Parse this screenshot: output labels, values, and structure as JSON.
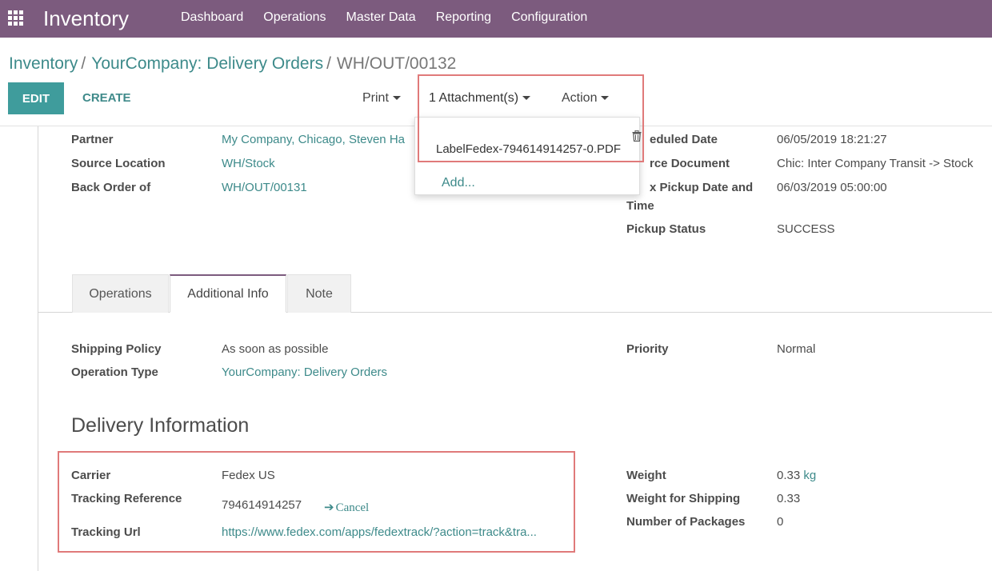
{
  "navbar": {
    "app_title": "Inventory",
    "menu": [
      "Dashboard",
      "Operations",
      "Master Data",
      "Reporting",
      "Configuration"
    ],
    "apps_icon": "grid-icon"
  },
  "breadcrumb": {
    "items": [
      "Inventory",
      "YourCompany: Delivery Orders"
    ],
    "current": "WH/OUT/00132"
  },
  "controls": {
    "edit_label": "EDIT",
    "create_label": "CREATE",
    "print_label": "Print",
    "attachments_label": "1 Attachment(s)",
    "action_label": "Action"
  },
  "attachments_dropdown": {
    "file_name": "LabelFedex-794614914257-0.PDF",
    "add_label": "Add...",
    "delete_icon": "trash-icon"
  },
  "header_fields": {
    "partner_label": "Partner",
    "partner_value": "My Company, Chicago, Steven Ha",
    "source_location_label": "Source Location",
    "source_location_value": "WH/Stock",
    "back_order_label": "Back Order of",
    "back_order_value": "WH/OUT/00131",
    "scheduled_date_label": "eduled Date",
    "scheduled_date_value": "06/05/2019 18:21:27",
    "source_document_label": "rce Document",
    "source_document_value": "Chic: Inter Company Transit -> Stock",
    "pickup_date_label_1": "x Pickup Date and",
    "pickup_date_label_2": "Time",
    "pickup_date_value": "06/03/2019 05:00:00",
    "pickup_status_label": "Pickup Status",
    "pickup_status_value": "SUCCESS"
  },
  "tabs": [
    "Operations",
    "Additional Info",
    "Note"
  ],
  "additional_info": {
    "shipping_policy_label": "Shipping Policy",
    "shipping_policy_value": "As soon as possible",
    "operation_type_label": "Operation Type",
    "operation_type_value": "YourCompany: Delivery Orders",
    "priority_label": "Priority",
    "priority_value": "Normal"
  },
  "delivery_info": {
    "title": "Delivery Information",
    "carrier_label": "Carrier",
    "carrier_value": "Fedex US",
    "tracking_ref_label": "Tracking Reference",
    "tracking_ref_value": "794614914257",
    "cancel_label": "Cancel",
    "tracking_url_label": "Tracking Url",
    "tracking_url_value": "https://www.fedex.com/apps/fedextrack/?action=track&tra...",
    "weight_label": "Weight",
    "weight_value": "0.33",
    "weight_unit": "kg",
    "weight_shipping_label": "Weight for Shipping",
    "weight_shipping_value": "0.33",
    "packages_label": "Number of Packages",
    "packages_value": "0"
  },
  "colors": {
    "navbar": "#7c5b7e",
    "primary_button": "#3f9c9c",
    "link": "#3d8a8a",
    "highlight": "#e07a7a"
  }
}
